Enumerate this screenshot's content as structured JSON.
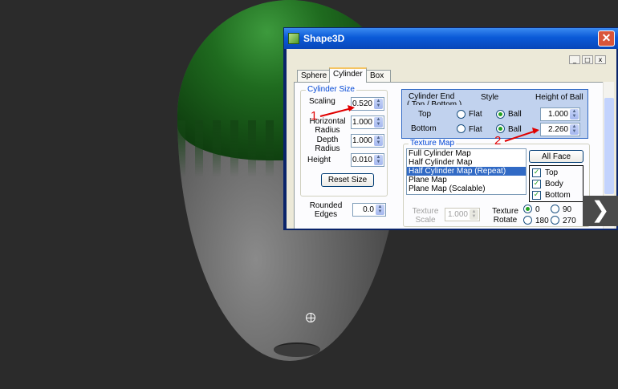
{
  "window": {
    "title": "Shape3D",
    "close_glyph": "✕"
  },
  "mdi_buttons": [
    "_",
    "□",
    "x"
  ],
  "tabs": [
    "Sphere",
    "Cylinder",
    "Box"
  ],
  "cylinder_size": {
    "group_label": "Cylinder Size",
    "fields": [
      {
        "label": "Scaling",
        "value": "0.520"
      },
      {
        "label": "Horizontal Radius",
        "value": "1.000"
      },
      {
        "label": "Depth Radius",
        "value": "1.000"
      },
      {
        "label": "Height",
        "value": "0.010"
      }
    ],
    "reset_label": "Reset Size"
  },
  "rounded_edges": {
    "label": "Rounded Edges",
    "value": "0.0"
  },
  "cylinder_end": {
    "header": "Cylinder End",
    "subheader": "( Top / Bottom )",
    "style_header": "Style",
    "height_header": "Height of Ball",
    "rows": [
      {
        "label": "Top",
        "flat": "Flat",
        "ball": "Ball",
        "selected": "ball",
        "height": "1.000"
      },
      {
        "label": "Bottom",
        "flat": "Flat",
        "ball": "Ball",
        "selected": "ball",
        "height": "2.260"
      }
    ]
  },
  "texture_map": {
    "group_label": "Texture Map",
    "items": [
      "Full Cylinder Map",
      "Half Cylinder Map",
      "Half Cylinder Map (Repeat)",
      "Plane Map",
      "Plane Map (Scalable)"
    ],
    "selected_index": 2,
    "scale_label": "Texture Scale",
    "scale_value": "1.000",
    "rotate_label": "Texture Rotate",
    "rotate_options": [
      "0",
      "90",
      "180",
      "270"
    ],
    "rotate_selected": "0"
  },
  "faces": {
    "all_face_label": "All Face",
    "items": [
      {
        "label": "Top",
        "checked": true
      },
      {
        "label": "Body",
        "checked": true
      },
      {
        "label": "Bottom",
        "checked": true
      }
    ]
  },
  "annotations": {
    "marker1": "1",
    "marker2": "2",
    "color": "#e00000"
  },
  "overlay": {
    "next_glyph": "❯"
  }
}
